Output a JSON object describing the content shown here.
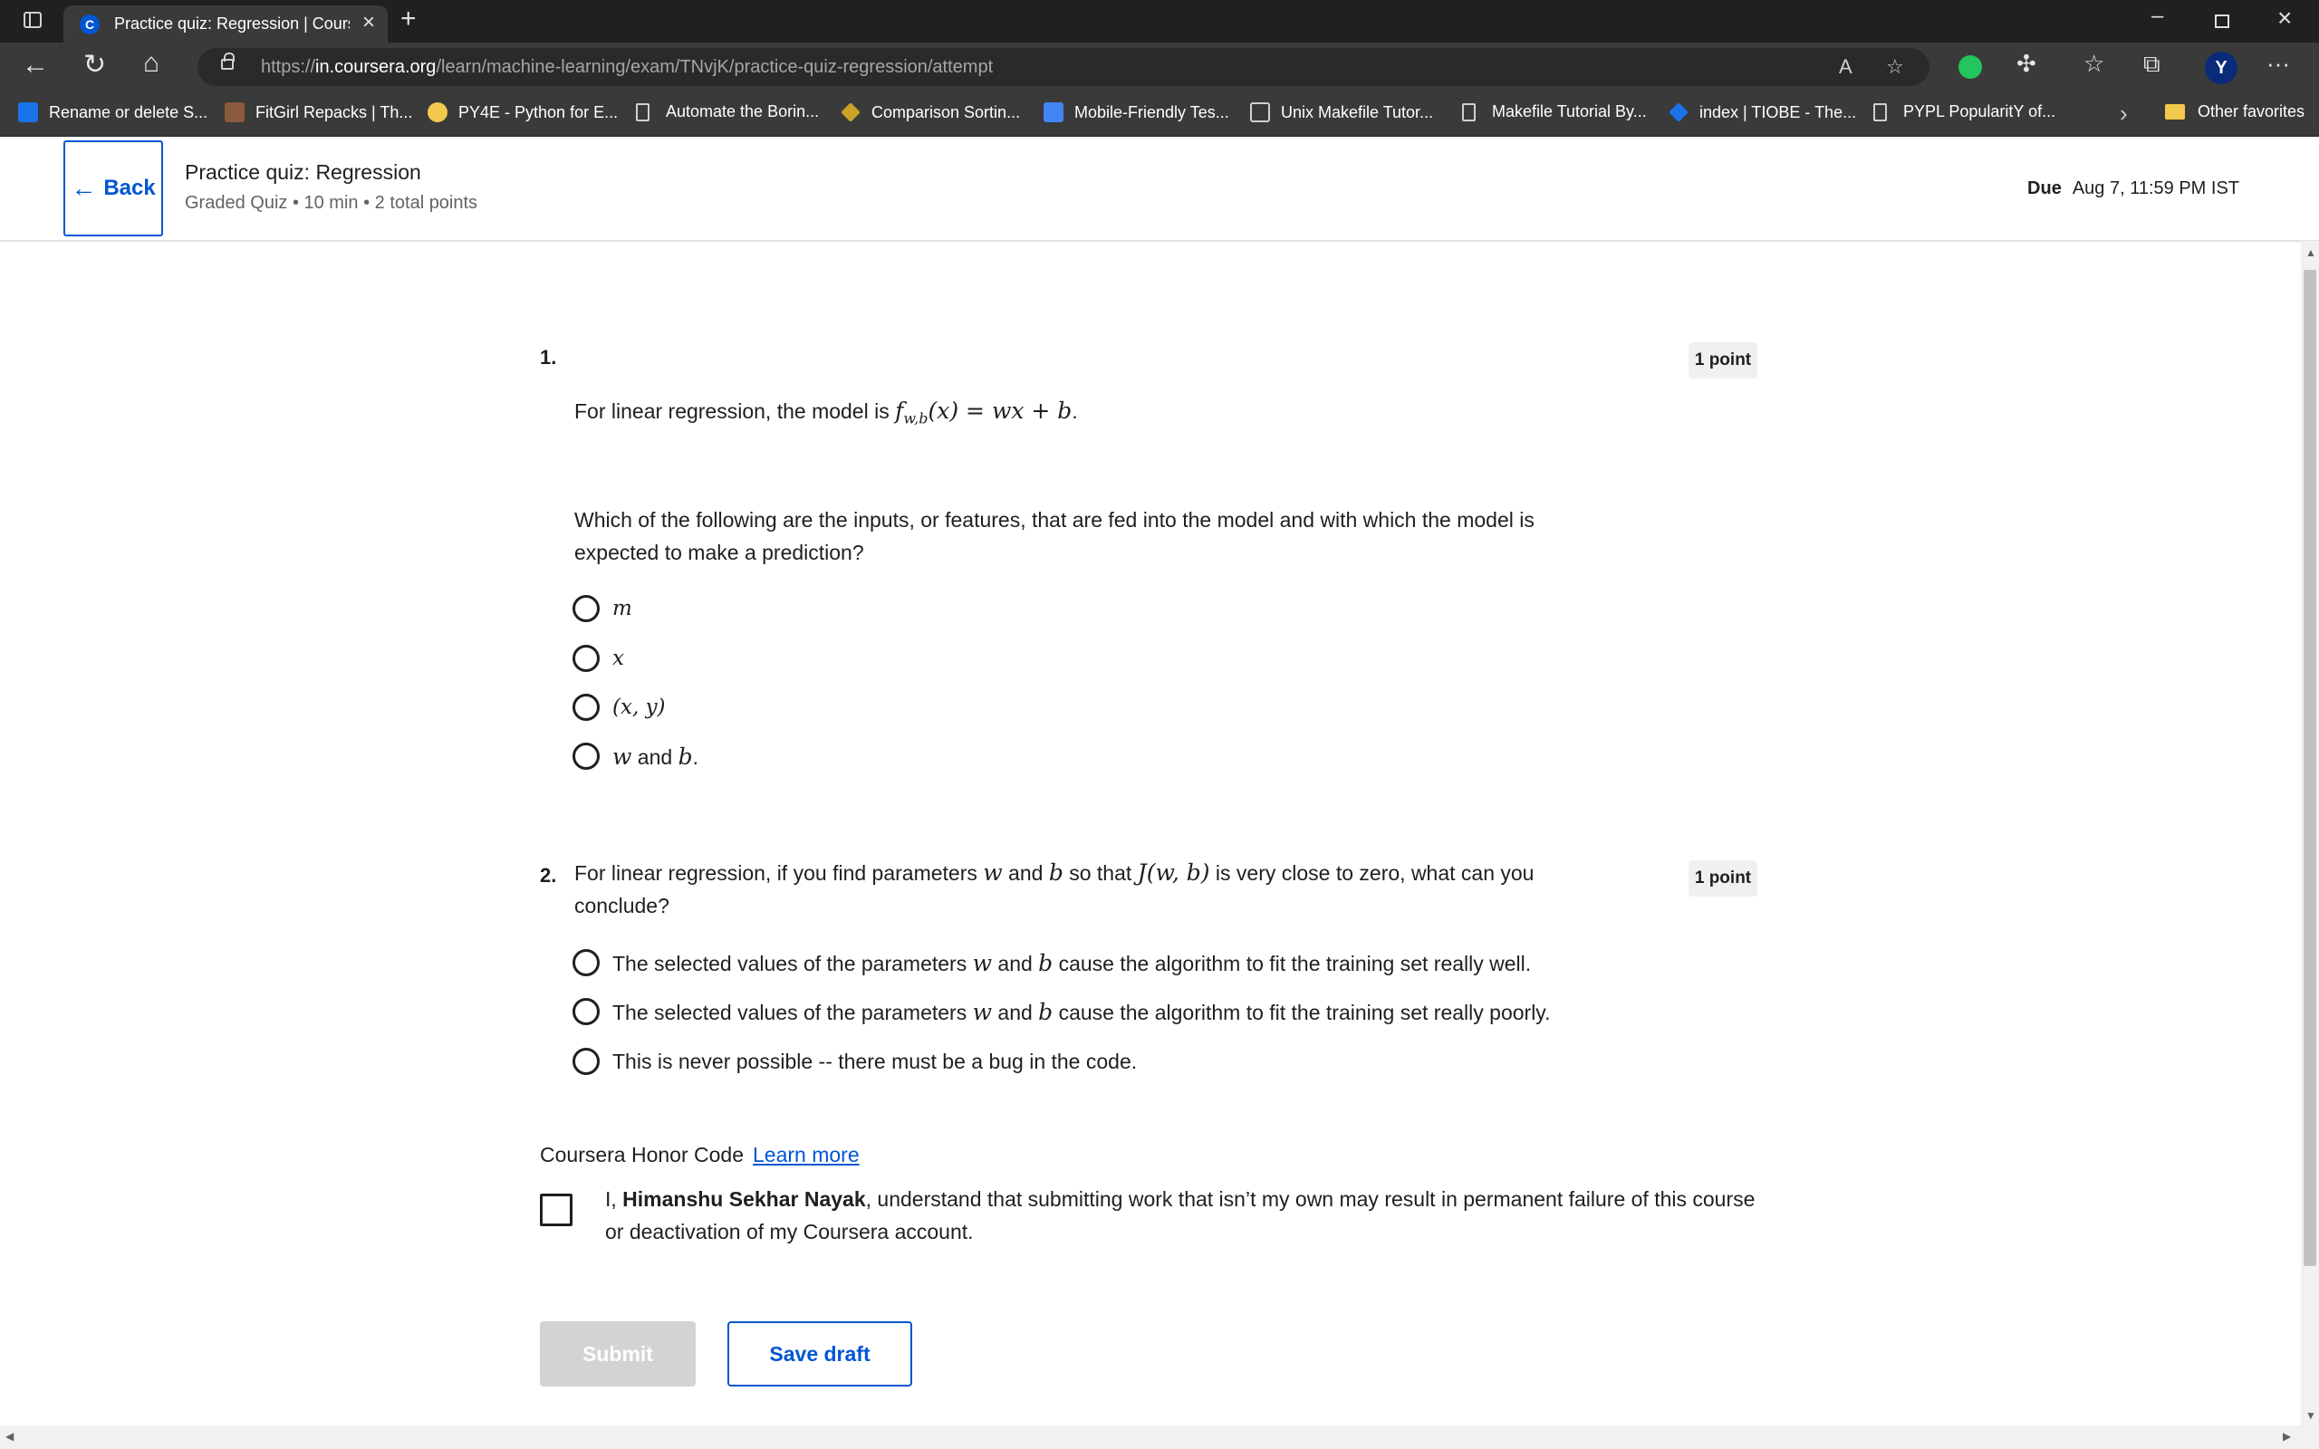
{
  "browser": {
    "tab_title": "Practice quiz: Regression | Coursera",
    "tab_favicon_letter": "C",
    "url_scheme": "https://",
    "url_host": "in.coursera.org",
    "url_path": "/learn/machine-learning/exam/TNvjK/practice-quiz-regression/attempt",
    "bookmarks": [
      {
        "label": "Rename or delete S...",
        "icon_color": "#1a73e8"
      },
      {
        "label": "FitGirl Repacks | Th...",
        "icon_color": "#8b5a3c"
      },
      {
        "label": "PY4E - Python for E...",
        "icon_color": "#f2c94c"
      },
      {
        "label": "Automate the Borin...",
        "icon_color": "doc"
      },
      {
        "label": "Comparison Sortin...",
        "icon_color": "#c9a227"
      },
      {
        "label": "Mobile-Friendly Tes...",
        "icon_color": "#4285f4"
      },
      {
        "label": "Unix Makefile Tutor...",
        "icon_color": "#d0d0d0"
      },
      {
        "label": "Makefile Tutorial By...",
        "icon_color": "doc"
      },
      {
        "label": "index | TIOBE - The...",
        "icon_color": "#1a73e8"
      },
      {
        "label": "PYPL PopularitY of...",
        "icon_color": "doc"
      }
    ],
    "other_favorites": "Other favorites",
    "profile_initial": "Y"
  },
  "header": {
    "back_label": "Back",
    "title": "Practice quiz: Regression",
    "meta": "Graded Quiz • 10 min • 2 total points",
    "due_label": "Due",
    "due_value": "Aug 7, 11:59 PM IST"
  },
  "questions": [
    {
      "number": "1.",
      "points": "1 point",
      "intro_prefix": "For linear regression, the model is ",
      "intro_math": "f",
      "intro_math_sub": "w,b",
      "intro_math_rest": "(x) = wx + b",
      "intro_suffix": ".",
      "prompt_line1": "Which of the following are the inputs, or features, that are fed into the model and with which the model is",
      "prompt_line2": "expected to make a prediction?",
      "options": [
        {
          "math": "m",
          "text": ""
        },
        {
          "math": "x",
          "text": ""
        },
        {
          "math": "(x, y)",
          "text": ""
        },
        {
          "math": "w",
          "text": " and ",
          "math2": "b",
          "end": "."
        }
      ]
    },
    {
      "number": "2.",
      "points": "1 point",
      "line1_a": "For linear regression, if you find parameters ",
      "line1_w": "w",
      "line1_b_pre": " and ",
      "line1_b": "b",
      "line1_c": " so that ",
      "line1_j": "J(w, b)",
      "line1_d": " is very close to zero, what can you",
      "line2": "conclude?",
      "options": [
        {
          "a": "The selected values of the parameters ",
          "w": "w",
          "and": " and ",
          "b": "b",
          "c": " cause the algorithm to fit the training set really well."
        },
        {
          "a": "The selected values of the parameters ",
          "w": "w",
          "and": " and ",
          "b": "b",
          "c": " cause the algorithm to fit the training set really poorly."
        },
        {
          "a": "This is never possible -- there must be a bug in the code."
        }
      ]
    }
  ],
  "honor": {
    "title": "Coursera Honor Code",
    "link": "Learn more",
    "text_pre": "I, ",
    "name": "Himanshu Sekhar Nayak",
    "text_post": ", understand that submitting work that isn’t my own may result in permanent failure of this course or deactivation of my Coursera account."
  },
  "actions": {
    "submit": "Submit",
    "save_draft": "Save draft"
  }
}
